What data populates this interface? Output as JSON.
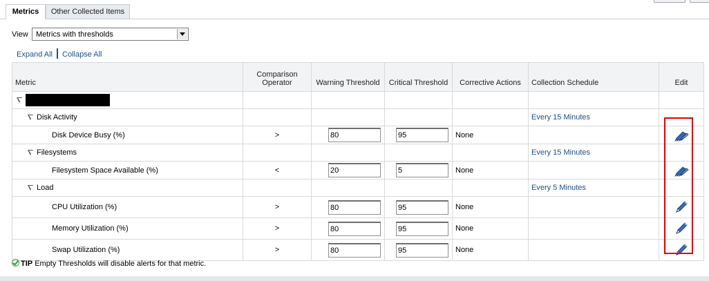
{
  "tabs": [
    {
      "label": "Metrics",
      "active": true
    },
    {
      "label": "Other Collected Items",
      "active": false
    }
  ],
  "view": {
    "label": "View",
    "selected": "Metrics with thresholds"
  },
  "links": {
    "expand_all": "Expand All",
    "collapse_all": "Collapse All"
  },
  "table": {
    "headers": {
      "metric": "Metric",
      "comparison_operator": "Comparison Operator",
      "warning": "Warning Threshold",
      "critical": "Critical Threshold",
      "corrective": "Corrective Actions",
      "schedule": "Collection Schedule",
      "edit": "Edit"
    },
    "rows": [
      {
        "type": "root",
        "name": ""
      },
      {
        "type": "group",
        "name": "Disk Activity",
        "schedule": "Every 15 Minutes"
      },
      {
        "type": "metric",
        "name": "Disk Device Busy (%)",
        "operator": ">",
        "warning": "80",
        "critical": "95",
        "corrective": "None",
        "edit_icon": "pencil-multi-icon"
      },
      {
        "type": "group",
        "name": "Filesystems",
        "schedule": "Every 15 Minutes"
      },
      {
        "type": "metric",
        "name": "Filesystem Space Available (%)",
        "operator": "<",
        "warning": "20",
        "critical": "5",
        "corrective": "None",
        "edit_icon": "pencil-multi-icon"
      },
      {
        "type": "group",
        "name": "Load",
        "schedule": "Every 5 Minutes"
      },
      {
        "type": "metric",
        "name": "CPU Utilization (%)",
        "operator": ">",
        "warning": "80",
        "critical": "95",
        "corrective": "None",
        "edit_icon": "pencil-icon"
      },
      {
        "type": "metric",
        "name": "Memory Utilization (%)",
        "operator": ">",
        "warning": "80",
        "critical": "95",
        "corrective": "None",
        "edit_icon": "pencil-icon"
      },
      {
        "type": "metric",
        "name": "Swap Utilization (%)",
        "operator": ">",
        "warning": "80",
        "critical": "95",
        "corrective": "None",
        "edit_icon": "pencil-icon"
      }
    ]
  },
  "tip": {
    "label": "TIP",
    "text": "Empty Thresholds will disable alerts for that metric."
  },
  "colors": {
    "link": "#1f4f8a",
    "highlight": "#e00000",
    "header_bg": "#f1f3f5"
  }
}
